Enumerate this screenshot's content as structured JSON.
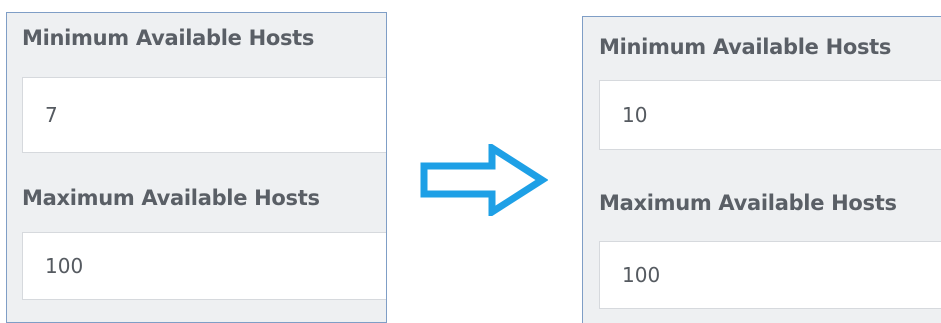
{
  "before": {
    "min_label": "Minimum Available Hosts",
    "min_value": "7",
    "max_label": "Maximum Available Hosts",
    "max_value": "100"
  },
  "after": {
    "min_label": "Minimum Available Hosts",
    "min_value": "10",
    "max_label": "Maximum Available Hosts",
    "max_value": "100"
  },
  "arrow": {
    "icon": "right-arrow-icon",
    "color": "#1ea0e6"
  },
  "colors": {
    "panel_border": "#7f9ec6",
    "panel_bg": "#eef0f2",
    "label_text": "#5a5f66",
    "input_text": "#555a60"
  }
}
